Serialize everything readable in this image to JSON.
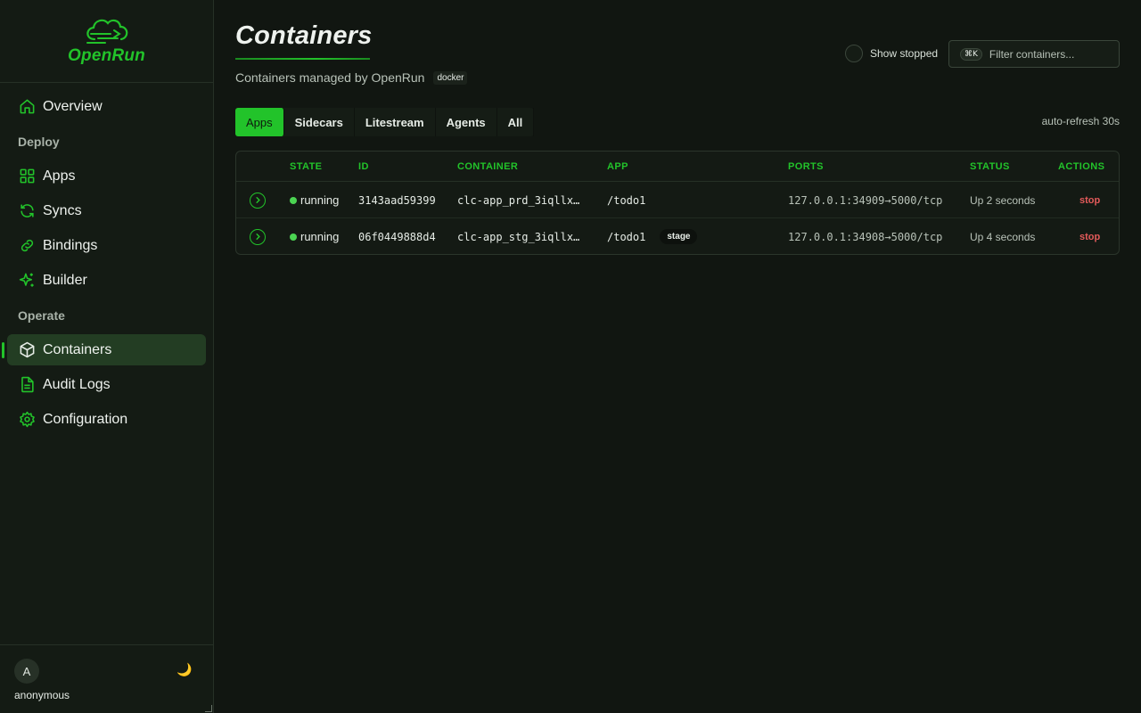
{
  "brand": {
    "name": "OpenRun"
  },
  "sidebar": {
    "items": [
      {
        "label": "Overview",
        "icon": "home-icon"
      },
      {
        "section": "Deploy"
      },
      {
        "label": "Apps",
        "icon": "grid-icon"
      },
      {
        "label": "Syncs",
        "icon": "refresh-icon"
      },
      {
        "label": "Bindings",
        "icon": "link-icon"
      },
      {
        "label": "Builder",
        "icon": "sparkle-icon"
      },
      {
        "section": "Operate"
      },
      {
        "label": "Containers",
        "icon": "box-icon",
        "active": true
      },
      {
        "label": "Audit Logs",
        "icon": "file-icon"
      },
      {
        "label": "Configuration",
        "icon": "gear-icon"
      }
    ],
    "sections": {
      "deploy": "Deploy",
      "operate": "Operate"
    },
    "overview": "Overview",
    "apps": "Apps",
    "syncs": "Syncs",
    "bindings": "Bindings",
    "builder": "Builder",
    "containers": "Containers",
    "audit_logs": "Audit Logs",
    "configuration": "Configuration"
  },
  "user": {
    "initial": "A",
    "name": "anonymous",
    "theme_icon": "🌙"
  },
  "header": {
    "title": "Containers",
    "subtitle": "Containers managed by OpenRun",
    "runtime_badge": "docker",
    "show_stopped_label": "Show stopped",
    "filter_shortcut": "⌘K",
    "filter_placeholder": "Filter containers..."
  },
  "tabs": [
    {
      "label": "Apps",
      "active": true
    },
    {
      "label": "Sidecars"
    },
    {
      "label": "Litestream"
    },
    {
      "label": "Agents"
    },
    {
      "label": "All"
    }
  ],
  "tab_labels": {
    "apps": "Apps",
    "sidecars": "Sidecars",
    "litestream": "Litestream",
    "agents": "Agents",
    "all": "All"
  },
  "auto_refresh": "auto-refresh 30s",
  "table": {
    "columns": {
      "state": "STATE",
      "id": "ID",
      "container": "CONTAINER",
      "app": "APP",
      "ports": "PORTS",
      "status": "STATUS",
      "actions": "ACTIONS"
    },
    "rows": [
      {
        "state": "running",
        "id": "3143aad59399",
        "container": "clc-app_prd_3iqllx…",
        "app": "/todo1",
        "badge": "",
        "ports": "127.0.0.1:34909→5000/tcp",
        "status": "Up 2 seconds",
        "action": "stop"
      },
      {
        "state": "running",
        "id": "06f0449888d4",
        "container": "clc-app_stg_3iqllx…",
        "app": "/todo1",
        "badge": "stage",
        "ports": "127.0.0.1:34908→5000/tcp",
        "status": "Up 4 seconds",
        "action": "stop"
      }
    ]
  },
  "colors": {
    "accent": "#22c32a",
    "danger": "#e35a5a",
    "background": "#111611"
  }
}
